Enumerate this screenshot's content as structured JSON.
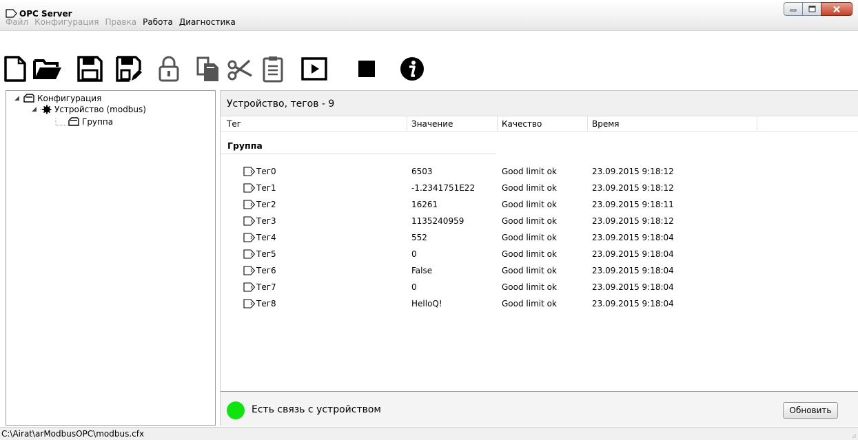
{
  "window": {
    "title": "OPC Server"
  },
  "menu": [
    {
      "label": "Файл",
      "enabled": false
    },
    {
      "label": "Конфигурация",
      "enabled": false
    },
    {
      "label": "Правка",
      "enabled": false
    },
    {
      "label": "Работа",
      "enabled": true
    },
    {
      "label": "Диагностика",
      "enabled": true
    }
  ],
  "toolbar": {
    "icons": [
      "new-file-icon",
      "open-folder-icon",
      "save-icon",
      "save-as-icon",
      "lock-icon",
      "copy-icon",
      "cut-icon",
      "paste-icon",
      "play-icon",
      "stop-icon",
      "info-icon"
    ]
  },
  "tree": {
    "root": "Конфигурация",
    "device": "Устройство (modbus)",
    "group": "Группа"
  },
  "panel": {
    "header": "Устройство, тегов - 9",
    "columns": [
      "Тег",
      "Значение",
      "Качество",
      "Время"
    ],
    "group_label": "Группа",
    "rows": [
      {
        "tag": "Тег0",
        "value": "6503",
        "quality": "Good limit ok",
        "time": "23.09.2015 9:18:12"
      },
      {
        "tag": "Тег1",
        "value": "-1.2341751E22",
        "quality": "Good limit ok",
        "time": "23.09.2015 9:18:12"
      },
      {
        "tag": "Тег2",
        "value": "16261",
        "quality": "Good limit ok",
        "time": "23.09.2015 9:18:11"
      },
      {
        "tag": "Тег3",
        "value": "1135240959",
        "quality": "Good limit ok",
        "time": "23.09.2015 9:18:12"
      },
      {
        "tag": "Тег4",
        "value": "552",
        "quality": "Good limit ok",
        "time": "23.09.2015 9:18:04"
      },
      {
        "tag": "Тег5",
        "value": "0",
        "quality": "Good limit ok",
        "time": "23.09.2015 9:18:04"
      },
      {
        "tag": "Тег6",
        "value": "False",
        "quality": "Good limit ok",
        "time": "23.09.2015 9:18:04"
      },
      {
        "tag": "Тег7",
        "value": "0",
        "quality": "Good limit ok",
        "time": "23.09.2015 9:18:04"
      },
      {
        "tag": "Тег8",
        "value": "HelloQ!",
        "quality": "Good limit ok",
        "time": "23.09.2015 9:18:04"
      }
    ],
    "status": {
      "text": "Есть связь с устройством",
      "color": "#10e310"
    },
    "refresh_label": "Обновить"
  },
  "statusbar": {
    "path": "C:\\Airat\\arModbusOPC\\modbus.cfx"
  }
}
